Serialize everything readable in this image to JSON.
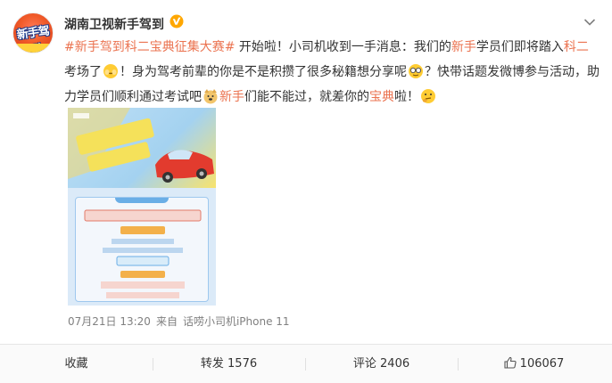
{
  "user": {
    "name": "湖南卫视新手驾到",
    "avatar_text": "新手驾到"
  },
  "post": {
    "tag": "#新手驾到科二宝典征集大赛#",
    "seg1": " 开始啦！小司机收到一手消息：我们的",
    "kw1": "新手",
    "seg2": "学员们即将踏入",
    "kw2": "科二",
    "seg3": "考场了",
    "seg4": "！身为驾考前辈的你是不是积攒了很多秘籍想分享呢",
    "seg5": "？快带话题发微博参与活动，助力学员们顺利通过考试吧",
    "kw3": "新手",
    "seg6": "们能不能过，就差你的",
    "kw4": "宝典",
    "seg7": "啦！"
  },
  "meta": {
    "time": "07月21日 13:20",
    "from_label": "来自",
    "source": "话唠小司机iPhone 11"
  },
  "actions": {
    "favorite": "收藏",
    "repost": "转发 1576",
    "comment": "评论 2406",
    "like": "106067"
  },
  "colors": {
    "accent": "#eb7350",
    "verified": "#ffa700"
  }
}
